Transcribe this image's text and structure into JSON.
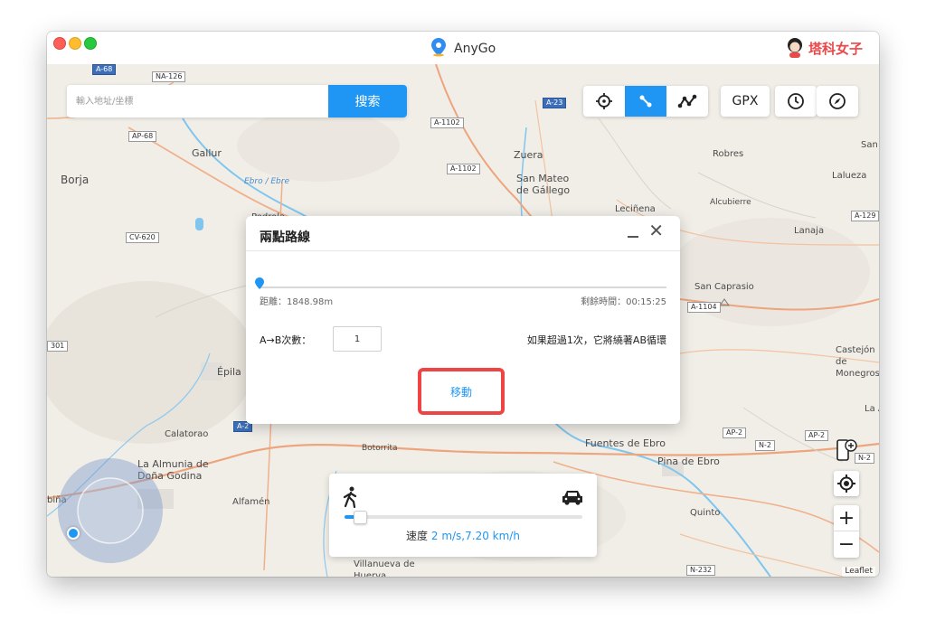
{
  "window": {
    "title": "AnyGo"
  },
  "watermark": {
    "text": "塔科女子"
  },
  "search": {
    "placeholder": "輸入地址/坐標",
    "button_label": "搜索"
  },
  "toolbar": {
    "mode_icons": [
      "crosshair-icon",
      "two-point-route-icon",
      "multi-point-route-icon"
    ],
    "active_mode": "two-point-route-icon",
    "gpx_label": "GPX",
    "extra_icons": [
      "history-clock-icon",
      "compass-icon"
    ]
  },
  "dialog": {
    "title": "兩點路線",
    "distance": "距離：1848.98m",
    "remaining": "剩餘時間：00:15:25",
    "progress_fraction": 0.0,
    "count_label": "A→B次數：",
    "count_value": "1",
    "hint": "如果超過1次，它將繞著AB循環",
    "move_label": "移動"
  },
  "speed": {
    "label": "速度",
    "value": "2 m/s,7.20 km/h",
    "fraction": 0.05
  },
  "map": {
    "places": [
      "Borja",
      "Gallur",
      "Ebro / Ebre",
      "Zuera",
      "San Mateo de Gállego",
      "Robres",
      "Lalueza",
      "San",
      "Leciñena",
      "Alcubierre",
      "Lanaja",
      "San Caprasio",
      "Castejón de Monegros",
      "La Alm",
      "Épila",
      "Calatorao",
      "La Almunia de Doña Godina",
      "Alfamén",
      "Botorrita",
      "Fuentes de Ebro",
      "Pina de Ebro",
      "Quinto",
      "Villanueva de Huerva",
      "biña",
      "Pedrola"
    ],
    "roads": [
      "A-68",
      "NA-126",
      "AP-68",
      "CV-620",
      "A-1102",
      "A-23",
      "A-129",
      "A-1104",
      "A-2",
      "AP-2",
      "N-2",
      "N-232",
      "301"
    ],
    "attribution": "Leaflet"
  }
}
